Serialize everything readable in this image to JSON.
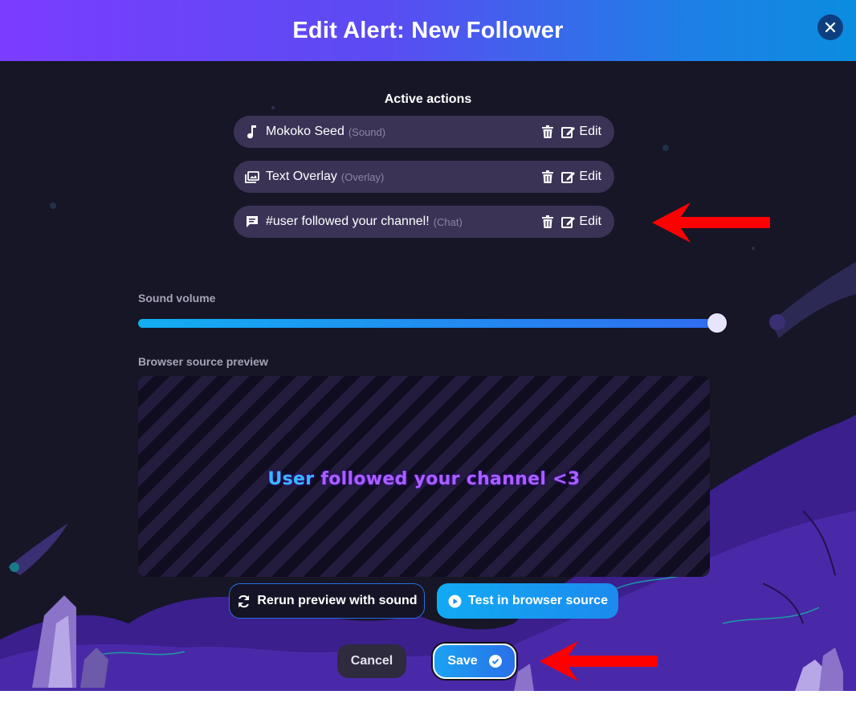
{
  "header": {
    "title": "Edit Alert: New Follower"
  },
  "actions": {
    "title": "Active actions",
    "edit_label": "Edit",
    "items": [
      {
        "name": "Mokoko Seed",
        "type": "(Sound)",
        "icon": "music-note-icon"
      },
      {
        "name": "Text Overlay",
        "type": "(Overlay)",
        "icon": "image-stack-icon"
      },
      {
        "name": "#user followed your channel!",
        "type": "(Chat)",
        "icon": "chat-bubble-icon"
      }
    ]
  },
  "sound": {
    "label": "Sound volume",
    "volume": 1.0
  },
  "preview": {
    "label": "Browser source preview",
    "text_user": "User",
    "text_rest": " followed your channel <3"
  },
  "buttons": {
    "rerun": "Rerun preview with sound",
    "test": "Test in browser source",
    "cancel": "Cancel",
    "save": "Save"
  },
  "colors": {
    "header_start": "#7b3cff",
    "header_end": "#0b8ddf",
    "accent": "#1c8aee",
    "annotation_arrow": "#ff0000"
  }
}
